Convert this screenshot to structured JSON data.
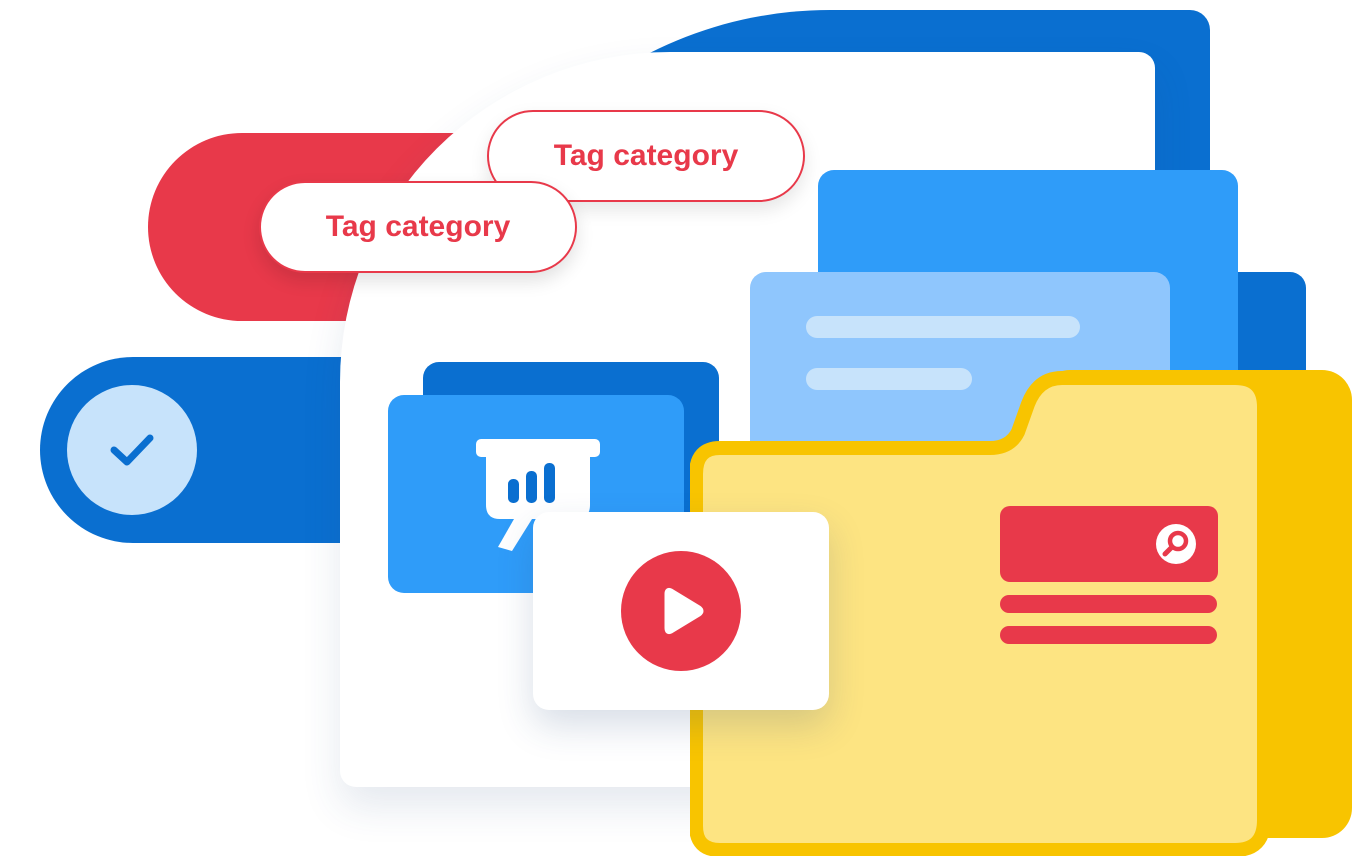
{
  "tags": {
    "back_label": "Tag category",
    "front_label": "Tag category"
  },
  "icons": {
    "check": "check-icon",
    "presentation": "presentation-chart-icon",
    "play": "play-icon",
    "search": "search-icon",
    "folder": "folder-icon"
  },
  "colors": {
    "primary_blue": "#0a6fd0",
    "bright_blue": "#2f9cf9",
    "light_blue": "#8fc6fd",
    "pale_blue": "#c7e3fb",
    "red": "#e8394a",
    "yellow": "#f8c400",
    "folder_fill": "#fde482",
    "white": "#ffffff"
  }
}
